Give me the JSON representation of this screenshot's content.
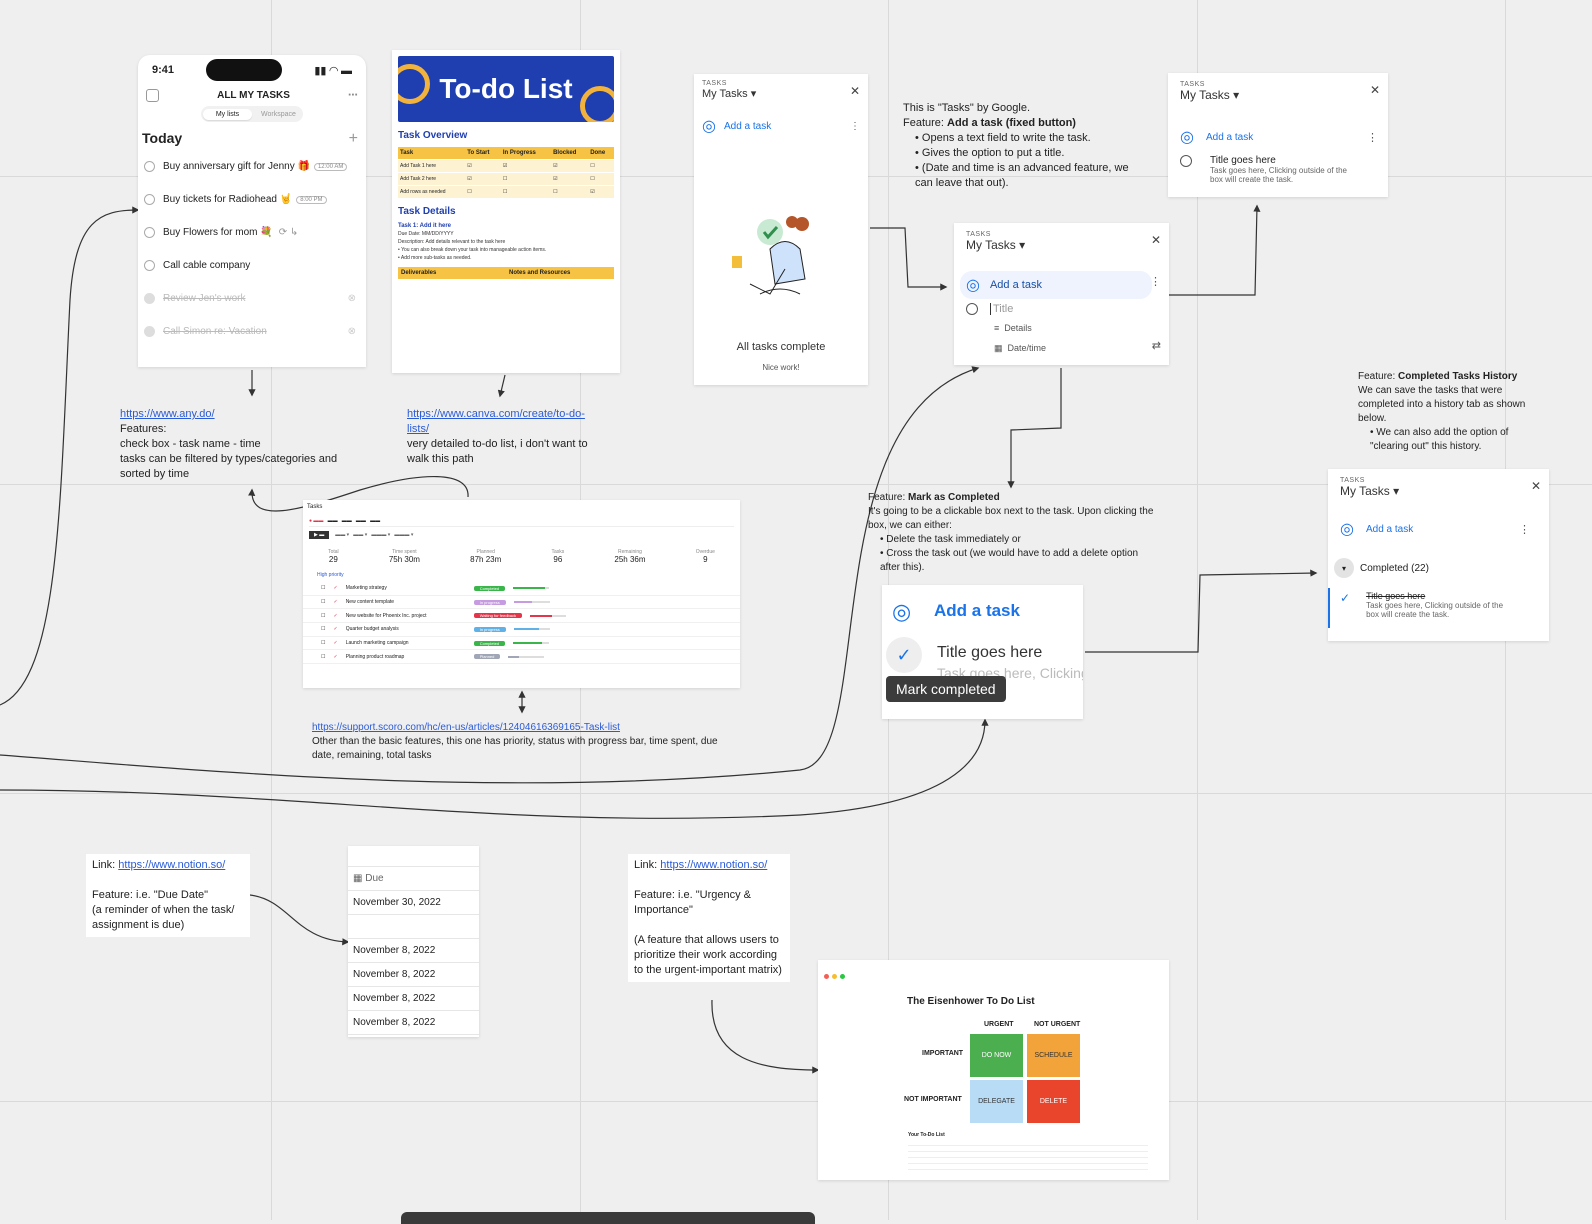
{
  "phone": {
    "time": "9:41",
    "title": "ALL MY TASKS",
    "tab_my": "My lists",
    "tab_work": "Workspace",
    "section": "Today",
    "tasks": [
      {
        "label": "Buy anniversary gift for Jenny 🎁",
        "chip": "12:00 AM",
        "done": false
      },
      {
        "label": "Buy tickets for Radiohead 🤘",
        "chip": "8:00 PM",
        "done": false
      },
      {
        "label": "Buy Flowers for mom 💐",
        "chip": "",
        "done": false
      },
      {
        "label": "Call cable company",
        "chip": "",
        "done": false
      },
      {
        "label": "Review Jen's work",
        "chip": "",
        "done": true
      },
      {
        "label": "Call Simon re: Vacation",
        "chip": "",
        "done": true
      }
    ]
  },
  "anydo_note": {
    "link": "https://www.any.do/",
    "line1": "Features:",
    "line2": "check box - task name - time",
    "line3": "tasks can be filtered by types/categories and sorted by time"
  },
  "canva": {
    "title": "To-do List",
    "overview": "Task Overview",
    "headers": [
      "Task",
      "To Start",
      "In Progress",
      "Blocked",
      "Done"
    ],
    "rows": [
      "Add Task 1 here",
      "Add Task 2 here",
      "Add rows as needed"
    ],
    "details_heading": "Task Details",
    "task1": "Task 1: Add it here",
    "due": "Due Date: MM/DD/YYYY",
    "desc": "Description: Add details relevant to the task here",
    "bullet1": "You can also break down your task into manageable action items.",
    "bullet2": "Add more sub-tasks as needed.",
    "deliverables": "Deliverables",
    "notes": "Notes and Resources"
  },
  "canva_note": {
    "link": "https://www.canva.com/create/to-do-lists/",
    "text": "very detailed to-do list, i don't want to walk this path"
  },
  "gtasks_empty": {
    "label": "TASKS",
    "list": "My Tasks",
    "add": "Add a task",
    "done": "All tasks complete",
    "nice": "Nice work!"
  },
  "google_note": {
    "intro": "This is \"Tasks\" by Google.",
    "feature_prefix": "Feature: ",
    "feature": "Add a task (fixed button)",
    "b1": "Opens a text field to write the task.",
    "b2": "Gives the option to put a title.",
    "b3": "(Date and time is an advanced feature, we can leave that out)."
  },
  "gtasks_title": {
    "label": "TASKS",
    "list": "My Tasks",
    "add": "Add a task",
    "item": "Title goes here",
    "item_sub": "Task goes here, Clicking outside of the box will create the task."
  },
  "gtasks_input": {
    "label": "TASKS",
    "list": "My Tasks",
    "add": "Add a task",
    "title_ph": "Title",
    "details": "Details",
    "datetime": "Date/time"
  },
  "history_note": {
    "feature_prefix": "Feature: ",
    "feature": "Completed Tasks History",
    "text": "We can save the tasks that were completed into a history tab as shown below.",
    "bullet": "We can also add the option of \"clearing out\" this history."
  },
  "gtasks_completed": {
    "label": "TASKS",
    "list": "My Tasks",
    "add": "Add a task",
    "completed": "Completed (22)",
    "item": "Title goes here",
    "item_sub": "Task goes here, Clicking outside of the box will create the task."
  },
  "mark_note": {
    "feature_prefix": "Feature: ",
    "feature": "Mark as Completed",
    "text": "It's going to be a clickable box next to the task. Upon clicking the box, we can either:",
    "b1": "Delete the task immediately or",
    "b2": "Cross the task out (we would have to add a delete option after this)."
  },
  "mark_card": {
    "add": "Add a task",
    "title": "Title goes here",
    "sub": "Task goes here, Clicking outside of the box will create the",
    "tooltip": "Mark completed"
  },
  "scoro": {
    "title": "Tasks",
    "stats": [
      {
        "label": "Total",
        "value": "29"
      },
      {
        "label": "Time spent",
        "value": "75h 30m"
      },
      {
        "label": "Planned",
        "value": "87h 23m"
      },
      {
        "label": "Tasks",
        "value": "96"
      },
      {
        "label": "Remaining",
        "value": "25h 36m"
      },
      {
        "label": "Overdue",
        "value": "9"
      }
    ],
    "group": "High priority",
    "rows": [
      {
        "name": "Marketing strategy",
        "tag": "Completed",
        "color": "#3ab54a",
        "prog": 0.9
      },
      {
        "name": "New content template",
        "tag": "In progress",
        "color": "#c79be0",
        "prog": 0.5
      },
      {
        "name": "New website for Phoenix Inc. project",
        "tag": "Waiting for feedback",
        "color": "#e4364a",
        "prog": 0.6
      },
      {
        "name": "Quarter budget analysis",
        "tag": "In progress",
        "color": "#62b1e6",
        "prog": 0.7
      },
      {
        "name": "Launch marketing campaign",
        "tag": "Completed",
        "color": "#3ab54a",
        "prog": 0.8
      },
      {
        "name": "Planning product roadmap",
        "tag": "Planned",
        "color": "#a0a6b6",
        "prog": 0.3
      }
    ]
  },
  "scoro_note": {
    "link": "https://support.scoro.com/hc/en-us/articles/12404616369165-Task-list",
    "text": "Other than the basic features, this one has priority, status with progress bar, time spent, due date, remaining, total tasks"
  },
  "notion_due_note": {
    "link_prefix": "Link: ",
    "link": "https://www.notion.so/",
    "f1": "Feature: i.e. \"Due Date\"",
    "f2": "(a reminder of when the task/ assignment is due)"
  },
  "notion_due": {
    "header": "Due",
    "dates": [
      "November 30, 2022",
      "",
      "November 8, 2022",
      "November 8, 2022",
      "November 8, 2022",
      "November 8, 2022"
    ]
  },
  "notion_matrix_note": {
    "link_prefix": "Link: ",
    "link": "https://www.notion.so/",
    "f1": "Feature: i.e. \"Urgency & Importance\"",
    "f2": "(A feature that allows users to prioritize their work according to the urgent-important matrix)"
  },
  "eisenhower": {
    "title": "The Eisenhower To Do List",
    "urgent": "URGENT",
    "not_urgent": "NOT URGENT",
    "important": "IMPORTANT",
    "not_important": "NOT IMPORTANT",
    "q1": "DO NOW",
    "q2": "SCHEDULE",
    "q3": "DELEGATE",
    "q4": "DELETE",
    "list_title": "Your To-Do List",
    "colors": {
      "q1": "#4bae4f",
      "q2": "#f2a43a",
      "q3": "#b9dcf6",
      "q4": "#e8452c"
    }
  }
}
